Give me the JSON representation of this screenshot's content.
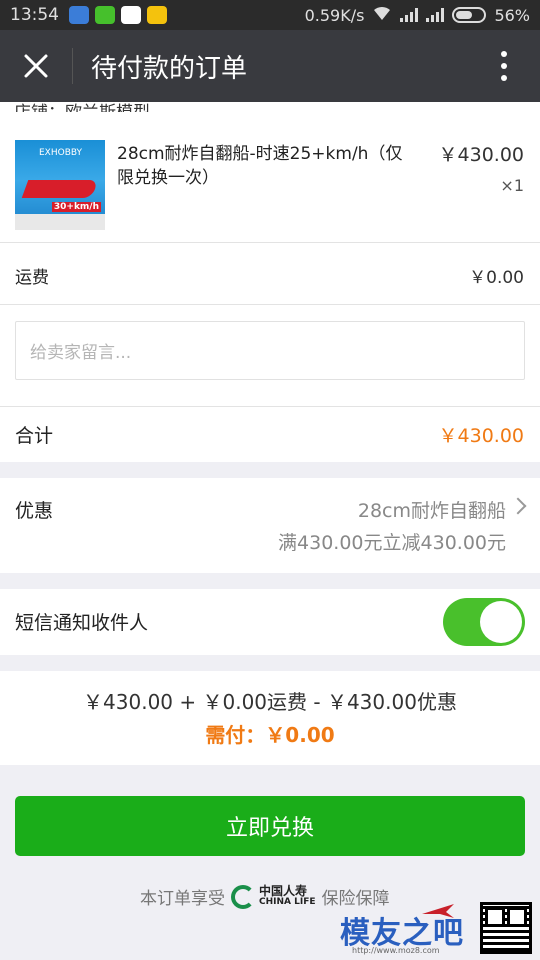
{
  "status_bar": {
    "time": "13:54",
    "network_speed": "0.59K/s",
    "battery": "56%"
  },
  "app_bar": {
    "title": "待付款的订单"
  },
  "shop_partial": "店铺：欧兰斯模型",
  "product": {
    "image_brand": "EXHOBBY",
    "image_speed": "30+km/h",
    "name": "28cm耐炸自翻船-时速25+km/h（仅限兑换一次）",
    "price": "￥430.00",
    "qty": "×1"
  },
  "shipping": {
    "label": "运费",
    "value": "￥0.00"
  },
  "message": {
    "placeholder": "给卖家留言..."
  },
  "total": {
    "label": "合计",
    "value": "￥430.00"
  },
  "discount": {
    "label": "优惠",
    "line1": "28cm耐炸自翻船",
    "line2": "满430.00元立减430.00元"
  },
  "sms": {
    "label": "短信通知收件人",
    "enabled": true
  },
  "summary": {
    "line1": "￥430.00 + ￥0.00运费 - ￥430.00优惠",
    "line2": "需付：￥0.00"
  },
  "action": {
    "label": "立即兑换"
  },
  "footer": {
    "prefix": "本订单享受",
    "logo_cn": "中国人寿",
    "logo_en": "CHINA LIFE",
    "suffix": "保险保障"
  },
  "watermark": {
    "text": "模友之吧",
    "url": "http://www.moz8.com"
  },
  "colors": {
    "accent_orange": "#f07a14",
    "primary_green": "#1aad19",
    "appbar": "#393a3f"
  }
}
